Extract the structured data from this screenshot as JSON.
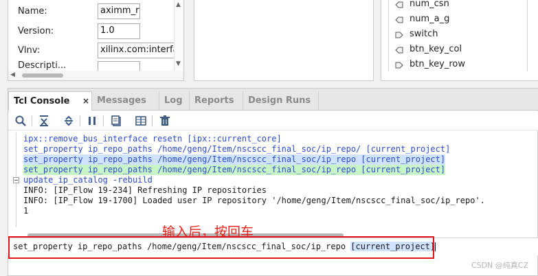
{
  "properties": {
    "name_label": "Name:",
    "name_value": "aximm_rtl",
    "version_label": "Version:",
    "version_value": "1.0",
    "vlnv_label": "Vlnv:",
    "vlnv_value": "xilinx.com:interfac",
    "desc_label": "Descripti..."
  },
  "ports": [
    "num_csn",
    "num_a_g",
    "switch",
    "btn_key_col",
    "btn_key_row"
  ],
  "tabs": {
    "tcl_console": "Tcl Console",
    "messages": "Messages",
    "log": "Log",
    "reports": "Reports",
    "design_runs": "Design Runs",
    "close_glyph": "×"
  },
  "console_lines": {
    "l1": "ipx::remove_bus_interface resetn [ipx::current_core]",
    "l2": "set_property ip_repo_paths /home/geng/Item/nscscc_final_soc/ip_repo/ [current_project]",
    "l3": "set_property ip_repo_paths /home/geng/Item/nscscc_final_soc/ip_repo [current_project]",
    "l4": "set_property ip_repo_paths /home/geng/Item/nscscc_final_soc/ip_repo [current_project]",
    "l5": "update_ip_catalog -rebuild",
    "l6": "INFO: [IP_Flow 19-234] Refreshing IP repositories",
    "l7": "INFO: [IP_Flow 19-1700] Loaded user IP repository '/home/geng/Item/nscscc_final_soc/ip_repo'.",
    "l8": "1"
  },
  "annotation": "输入后，按回车",
  "input": {
    "prefix": "set_property ip_repo_paths /home/geng/Item/nscscc_final_soc/ip_repo ",
    "selected": "[current_project]"
  },
  "watermark": "CSDN @纯真CZ",
  "colors": {
    "command_text": "#2a4bcf",
    "highlight_blue": "#cfe2ff",
    "highlight_green": "#c8f5c8",
    "annotation_red": "#e8201a"
  },
  "icons": [
    "search-icon",
    "collapse-all-icon",
    "expand-all-icon",
    "pause-icon",
    "copy-icon",
    "show-columns-icon",
    "delete-icon"
  ]
}
